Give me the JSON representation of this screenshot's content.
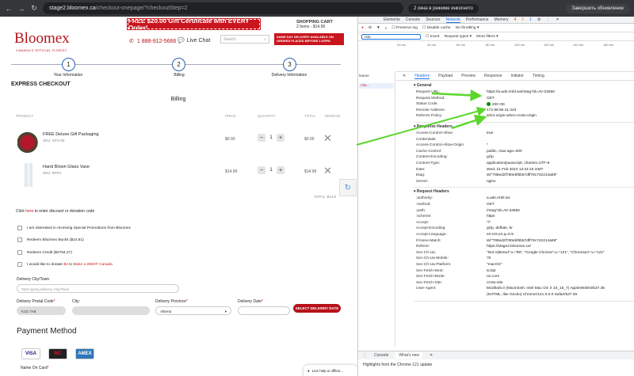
{
  "browser": {
    "url_host": "stage2.bloomex.ca",
    "url_path": "/checkout-onepage/?checkoutStep=2",
    "incognito_label": "2 окна в режиме инкогнито",
    "update_label": "Завершить обновление",
    "back_icon": "arrow-left-icon",
    "forward_icon": "arrow-right-icon",
    "reload_icon": "reload-icon"
  },
  "site": {
    "logo": "Bloomex",
    "logo_sub": "CANADA'S OFFICIAL FLORIST",
    "promo": "FREE $20.00 Gift Certificate with EVERY Order!",
    "phone": "1 888-912-5666",
    "live_chat": "Live Chat",
    "search_placeholder": "Search",
    "cart_title": "SHOPPING CART",
    "cart_summary": "2 Items - $14.99",
    "same_day": "SAME DAY DELIVERY AVAILABLE ON ORDERS PLACED BEFORE 1:00PM",
    "steps": [
      {
        "num": "1",
        "label": "Your Information"
      },
      {
        "num": "2",
        "label": "Billing"
      },
      {
        "num": "3",
        "label": "Delivery Information"
      }
    ],
    "express_title": "EXPRESS CHECKOUT",
    "billing_title": "Billing",
    "table_headers": {
      "product": "PRODUCT",
      "price": "PRICE",
      "quantity": "QUANTITY",
      "total": "TOTAL",
      "remove": "REMOVE"
    },
    "products": [
      {
        "name": "FREE Deluxe Gift Packaging",
        "sku": "SKU: SPU-05",
        "price": "$0.00",
        "qty": "1",
        "total": "$0.00"
      },
      {
        "name": "Hand Blown Glass Vase",
        "sku": "SKU: RP04",
        "price": "$14.99",
        "qty": "1",
        "total": "$14.99"
      }
    ],
    "total_label": "TOTAL: $14.9",
    "discount_prefix": "Click ",
    "discount_link": "here",
    "discount_suffix": " to enter discount or donation code",
    "checkboxes": [
      {
        "label": "I am interested in receiving Special Promotions from Bloomex",
        "extra": ""
      },
      {
        "label": "Redeem Bloomex Bucks ($14.81)",
        "extra": ""
      },
      {
        "label": "Redeem Credit ($4784.27)",
        "extra": ""
      },
      {
        "label": "I would like to donate ",
        "amount": "$2",
        "mid": " to ",
        "extra": "Make a Wish® Canada"
      }
    ],
    "delivery_city_label": "Delivery City/Town",
    "delivery_city_placeholder": "Start typing delivery City/Town",
    "postal_label": "Delivery Postal Code",
    "postal_value": "K1G 7A8",
    "city_label": "City:",
    "province_label": "Delivery Province",
    "province_value": "Alberta",
    "date_label": "Delivery Date",
    "select_date_btn": "SELECT DELIVERY DATE",
    "payment_title": "Payment Method",
    "cards": [
      "VISA",
      "MC",
      "AMEX"
    ],
    "name_on_card": "Name On Card",
    "live_help": "Live help is offline..."
  },
  "devtools": {
    "tabs": [
      "Elements",
      "Console",
      "Sources",
      "Network",
      "Performance",
      "Memory"
    ],
    "active_tab": "Network",
    "badges": {
      "errors": "4",
      "warnings": "1",
      "issues": "1"
    },
    "preserve_log": "Preserve log",
    "disable_cache": "Disable cache",
    "throttling": "No throttling",
    "filter_value": "rsta",
    "invert": "Invert",
    "request_types": "Request types",
    "more_filters": "More filters",
    "timeline_ticks": [
      "20 ms",
      "40 ms",
      "60 ms",
      "80 ms",
      "100 ms",
      "120 ms",
      "140 ms",
      "160 ms"
    ],
    "name_col": "Name",
    "request_name": "rsta...",
    "subtabs": [
      "Headers",
      "Payload",
      "Preview",
      "Response",
      "Initiator",
      "Timing"
    ],
    "active_subtab": "Headers",
    "general_title": "▾ General",
    "general": [
      {
        "k": "Request URL:",
        "v": "https://a.ads.rmbl.ws/rstag?id=AV-23650"
      },
      {
        "k": "Request Method:",
        "v": "GET"
      },
      {
        "k": "Status Code:",
        "v": "200 OK"
      },
      {
        "k": "Remote Address:",
        "v": "172.98.56.41:443"
      },
      {
        "k": "Referrer Policy:",
        "v": "strict-origin-when-cross-origin"
      }
    ],
    "response_title": "▾ Response Headers",
    "response": [
      {
        "k": "Access-Control-Allow-",
        "v": "true"
      },
      {
        "k": "Credentials:",
        "v": ""
      },
      {
        "k": "Access-Control-Allow-Origin:",
        "v": "*"
      },
      {
        "k": "Cache-Control:",
        "v": "public, max-age=300"
      },
      {
        "k": "Content-Encoding:",
        "v": "gzip"
      },
      {
        "k": "Content-Type:",
        "v": "application/javascript; charset=UTF-8"
      },
      {
        "k": "Date:",
        "v": "Wed, 21 Feb 2024 13:24:15 GMT"
      },
      {
        "k": "Etag:",
        "v": "W/\"788ed2f780ebf5b57dff78c742214a69\""
      },
      {
        "k": "Server:",
        "v": "nginx"
      }
    ],
    "request_title": "▾ Request Headers",
    "request": [
      {
        "k": ":authority:",
        "v": "a.ads.rmbl.ws"
      },
      {
        "k": ":method:",
        "v": "GET"
      },
      {
        "k": ":path:",
        "v": "/rstag?id=AV-23650"
      },
      {
        "k": ":scheme:",
        "v": "https"
      },
      {
        "k": "Accept:",
        "v": "*/*"
      },
      {
        "k": "Accept-Encoding:",
        "v": "gzip, deflate, br"
      },
      {
        "k": "Accept-Language:",
        "v": "en-US,en;q=0.9"
      },
      {
        "k": "If-None-Match:",
        "v": "W/\"788ed2f780ebf5b57dff78c742214a69\""
      },
      {
        "k": "Referer:",
        "v": "https://stage2.bloomex.ca/"
      },
      {
        "k": "Sec-Ch-Ua:",
        "v": "\"Not A(Brand\";v=\"99\", \"Google Chrome\";v=\"121\", \"Chromium\";v=\"121\""
      },
      {
        "k": "Sec-Ch-Ua-Mobile:",
        "v": "?0"
      },
      {
        "k": "Sec-Ch-Ua-Platform:",
        "v": "\"macOS\""
      },
      {
        "k": "Sec-Fetch-Dest:",
        "v": "script"
      },
      {
        "k": "Sec-Fetch-Mode:",
        "v": "no-cors"
      },
      {
        "k": "Sec-Fetch-Site:",
        "v": "cross-site"
      },
      {
        "k": "User-Agent:",
        "v": "Mozilla/5.0 (Macintosh; Intel Mac OS X 10_15_7) AppleWebKit/537.36"
      },
      {
        "k": "",
        "v": "(KHTML, like Gecko) Chrome/121.0.0.0 Safari/537.36"
      }
    ],
    "req_count": "1 / 123",
    "drawer_tabs": [
      "Console",
      "What's new"
    ],
    "drawer_msg": "Highlights from the Chrome 121 update"
  }
}
